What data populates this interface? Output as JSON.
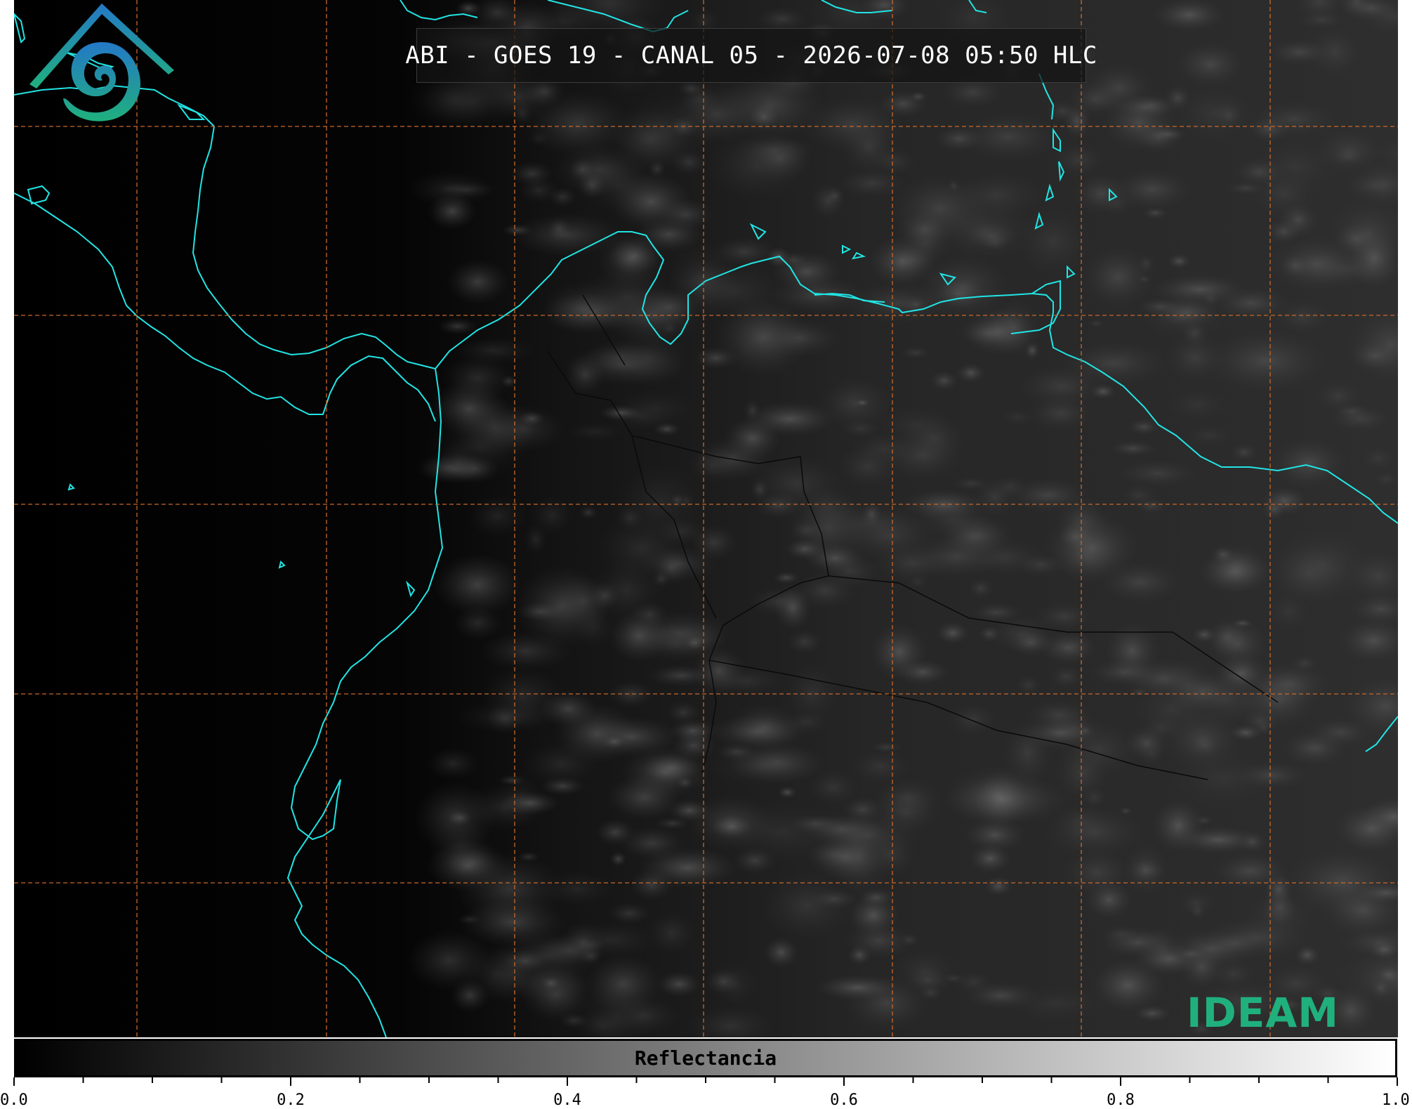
{
  "title": "ABI - GOES 19 - CANAL 05 - 2026-07-08 05:50 HLC",
  "logo": {
    "name": "IDEAM",
    "icon": "ideam-spiral-logo"
  },
  "colors": {
    "coastline": "#22e4e4",
    "gridlines": "#c8682a",
    "background": "#000000",
    "logo_top": "#2478c6",
    "logo_bottom": "#20b07e"
  },
  "colorbar": {
    "label": "Reflectancia",
    "min": 0.0,
    "max": 1.0,
    "tick_labels": [
      "0.0",
      "0.2",
      "0.4",
      "0.6",
      "0.8",
      "1.0"
    ],
    "tick_values": [
      0.0,
      0.2,
      0.4,
      0.6,
      0.8,
      1.0
    ],
    "minor_step": 0.05,
    "colormap": "grayscale"
  },
  "map": {
    "gridlines": "dashed",
    "coastlines": true,
    "borders": true
  }
}
